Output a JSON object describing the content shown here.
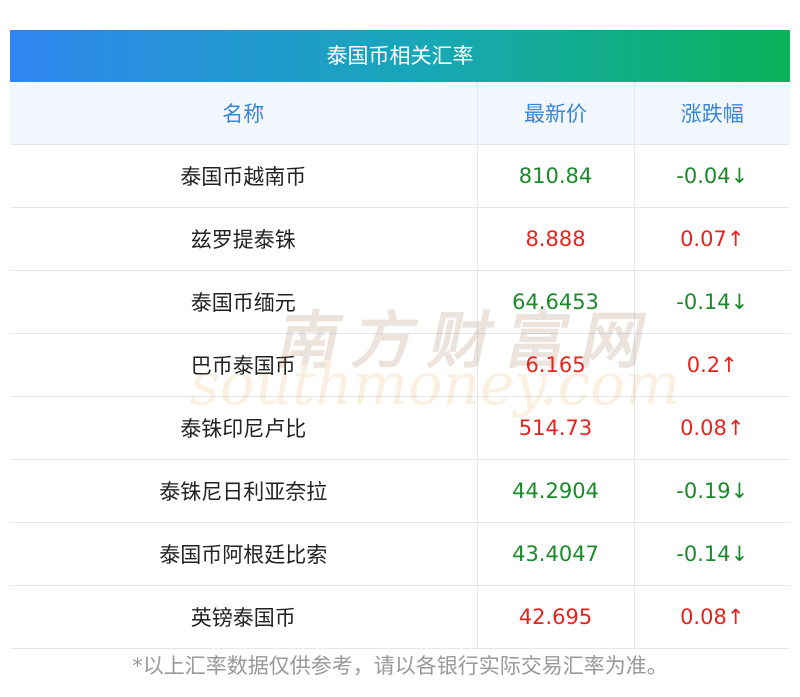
{
  "title": "泰国币相关汇率",
  "columns": [
    "名称",
    "最新价",
    "涨跌幅"
  ],
  "rows": [
    {
      "name": "泰国币越南币",
      "price": "810.84",
      "change": "-0.04↓",
      "direction": "down"
    },
    {
      "name": "兹罗提泰铢",
      "price": "8.888",
      "change": "0.07↑",
      "direction": "up"
    },
    {
      "name": "泰国币缅元",
      "price": "64.6453",
      "change": "-0.14↓",
      "direction": "down"
    },
    {
      "name": "巴币泰国币",
      "price": "6.165",
      "change": "0.2↑",
      "direction": "up"
    },
    {
      "name": "泰铢印尼卢比",
      "price": "514.73",
      "change": "0.08↑",
      "direction": "up"
    },
    {
      "name": "泰铢尼日利亚奈拉",
      "price": "44.2904",
      "change": "-0.19↓",
      "direction": "down"
    },
    {
      "name": "泰国币阿根廷比索",
      "price": "43.4047",
      "change": "-0.14↓",
      "direction": "down"
    },
    {
      "name": "英镑泰国币",
      "price": "42.695",
      "change": "0.08↑",
      "direction": "up"
    }
  ],
  "footnote": "*以上汇率数据仅供参考，请以各银行实际交易汇率为准。",
  "watermark": {
    "cn": "南方财富网",
    "en": "southmoney.com"
  },
  "colors": {
    "up": "#e8231f",
    "down": "#1a8a2a",
    "header_start": "#2f86f0",
    "header_end": "#0bb25a"
  }
}
